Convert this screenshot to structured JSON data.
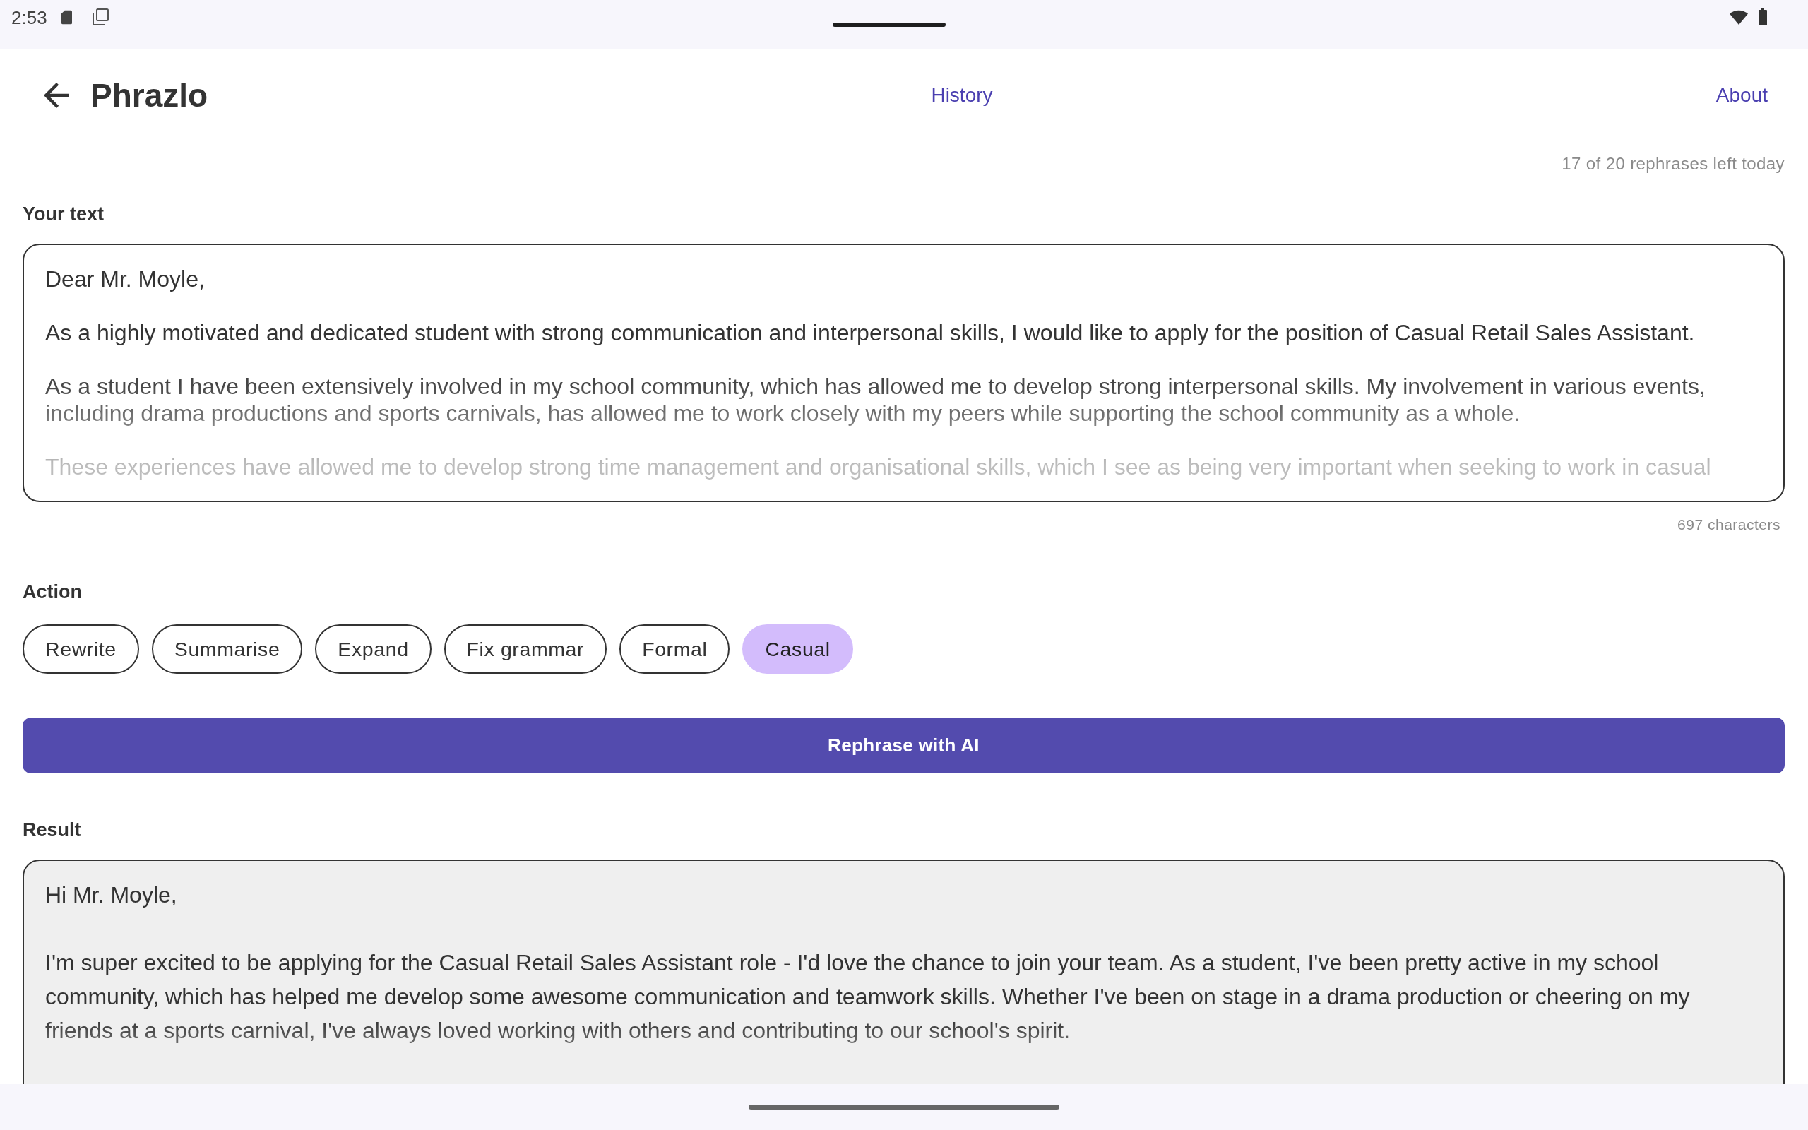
{
  "status_bar": {
    "time": "2:53"
  },
  "app_bar": {
    "title": "Phrazlo",
    "links": [
      {
        "label": "History"
      },
      {
        "label": "About"
      }
    ]
  },
  "usage": "17 of 20 rephrases left today",
  "input": {
    "label": "Your text",
    "paragraphs": [
      "Dear Mr. Moyle,",
      "As a highly motivated and dedicated student with strong communication and interpersonal skills, I would like to apply for the position of Casual Retail Sales Assistant.",
      "As a student I have been extensively involved in my school community, which has allowed me to develop strong interpersonal skills. My involvement in various events, including drama productions and sports carnivals, has allowed me to work closely with my peers while supporting the school community as a whole.",
      "These experiences have allowed me to develop strong time management and organisational skills, which I see as being very important when seeking to work in casual"
    ],
    "char_count": "697 characters"
  },
  "action": {
    "label": "Action",
    "options": [
      {
        "label": "Rewrite",
        "selected": false
      },
      {
        "label": "Summarise",
        "selected": false
      },
      {
        "label": "Expand",
        "selected": false
      },
      {
        "label": "Fix grammar",
        "selected": false
      },
      {
        "label": "Formal",
        "selected": false
      },
      {
        "label": "Casual",
        "selected": true
      }
    ]
  },
  "submit_button": {
    "label": "Rephrase with AI"
  },
  "result": {
    "label": "Result",
    "paragraphs": [
      "Hi Mr. Moyle,",
      "I'm super excited to be applying for the Casual Retail Sales Assistant role - I'd love the chance to join your team. As a student, I've been pretty active in my school community, which has helped me develop some awesome communication and teamwork skills. Whether I've been on stage in a drama production or cheering on my friends at a sports carnival, I've always loved working with others and contributing to our school's spirit."
    ]
  }
}
